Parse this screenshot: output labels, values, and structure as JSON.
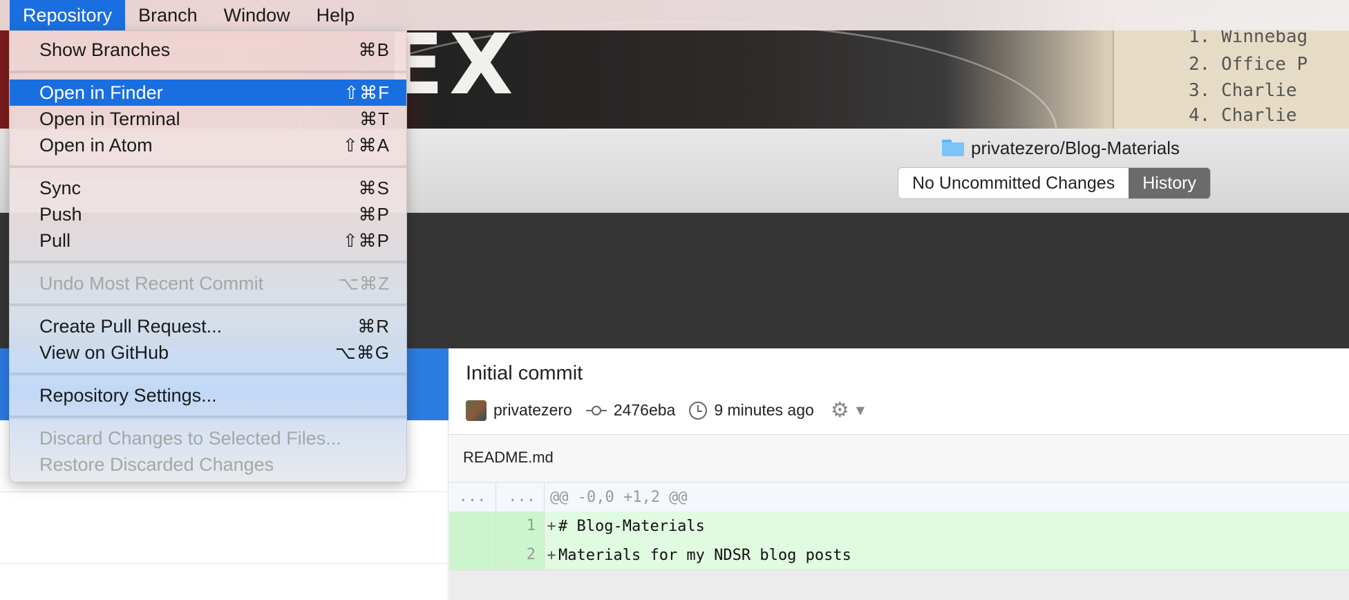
{
  "menubar": {
    "items": [
      {
        "label": "Repository",
        "active": true
      },
      {
        "label": "Branch",
        "active": false
      },
      {
        "label": "Window",
        "active": false
      },
      {
        "label": "Help",
        "active": false
      }
    ]
  },
  "wallpaper": {
    "big_text": "EX",
    "lines": [
      "1.  Winnebag",
      "2.  Office P",
      "3.  Charlie",
      "4.  Charlie"
    ]
  },
  "menu": {
    "items": [
      {
        "label": "Show Branches",
        "shortcut": "⌘B",
        "state": "normal"
      },
      {
        "label": "Open in Finder",
        "shortcut": "⇧⌘F",
        "state": "highlighted"
      },
      {
        "label": "Open in Terminal",
        "shortcut": "⌘T",
        "state": "normal"
      },
      {
        "label": "Open in Atom",
        "shortcut": "⇧⌘A",
        "state": "normal"
      },
      {
        "label": "Sync",
        "shortcut": "⌘S",
        "state": "normal"
      },
      {
        "label": "Push",
        "shortcut": "⌘P",
        "state": "normal"
      },
      {
        "label": "Pull",
        "shortcut": "⇧⌘P",
        "state": "normal"
      },
      {
        "label": "Undo Most Recent Commit",
        "shortcut": "⌥⌘Z",
        "state": "disabled"
      },
      {
        "label": "Create Pull Request...",
        "shortcut": "⌘R",
        "state": "normal"
      },
      {
        "label": "View on GitHub",
        "shortcut": "⌥⌘G",
        "state": "normal"
      },
      {
        "label": "Repository Settings...",
        "shortcut": "",
        "state": "normal"
      },
      {
        "label": "Discard Changes to Selected Files...",
        "shortcut": "",
        "state": "disabled"
      },
      {
        "label": "Restore Discarded Changes",
        "shortcut": "",
        "state": "disabled"
      }
    ]
  },
  "toolbar": {
    "repo_title": "privatezero/Blog-Materials",
    "folder_icon": "folder-icon",
    "segments": [
      {
        "label": "No Uncommitted Changes",
        "selected": false
      },
      {
        "label": "History",
        "selected": true
      }
    ]
  },
  "commit": {
    "title": "Initial commit",
    "author": "privatezero",
    "sha": "2476eba",
    "time": "9 minutes ago",
    "gear_icon": "gear-icon",
    "file": "README.md"
  },
  "diff": {
    "hunk": {
      "old": "...",
      "new": "...",
      "text": "@@ -0,0 +1,2 @@"
    },
    "lines": [
      {
        "old": "",
        "new": "1",
        "sign": "+",
        "text": "# Blog-Materials"
      },
      {
        "old": "",
        "new": "2",
        "sign": "+",
        "text": "Materials for my NDSR blog posts"
      }
    ]
  },
  "colors": {
    "accent": "#1a6fe0",
    "sidebar_selection": "#2c7be0",
    "diff_added": "#e0fbe0",
    "toolbar_segment_selected": "#6b6b6b"
  }
}
